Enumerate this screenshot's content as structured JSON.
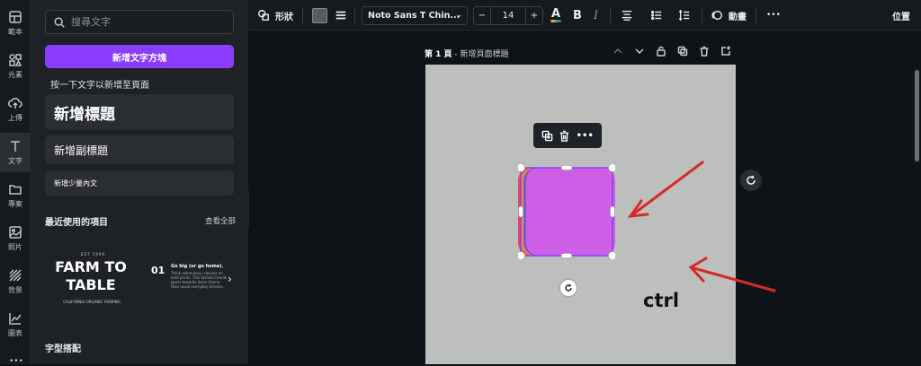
{
  "rail": {
    "items": [
      {
        "label": "範本",
        "icon": "template-icon"
      },
      {
        "label": "元素",
        "icon": "elements-icon"
      },
      {
        "label": "上傳",
        "icon": "upload-icon"
      },
      {
        "label": "文字",
        "icon": "text-icon"
      },
      {
        "label": "專案",
        "icon": "folder-icon"
      },
      {
        "label": "照片",
        "icon": "photo-icon"
      },
      {
        "label": "背景",
        "icon": "background-icon"
      },
      {
        "label": "圖表",
        "icon": "chart-icon"
      }
    ]
  },
  "panel": {
    "search_placeholder": "搜尋文字",
    "add_text_button": "新增文字方塊",
    "hint": "按一下文字以新增至頁面",
    "heading_card": "新增標題",
    "subheading_card": "新增副標題",
    "body_card": "新增少量內文",
    "recent_title": "最近使用的項目",
    "see_all": "查看全部",
    "template": {
      "est": "EST 1999",
      "title": "FARM TO\nTABLE",
      "subline": "CALIFORNIA ORGANIC FARMING",
      "number": "01",
      "heading": "Go big (or go home).",
      "paragraph": "Think voluminous sleeves on bold prints. This fashion trends gears towards more drama than usual everyday dresses."
    },
    "pairing_title": "字型搭配"
  },
  "toolbar": {
    "shape_label": "形狀",
    "font_name": "Noto Sans T Chin...",
    "font_size": "14",
    "size_minus": "−",
    "size_plus": "+",
    "bold": "B",
    "italic": "I",
    "animate_label": "動畫",
    "more": "•••",
    "position_label": "位置",
    "fill_color": "#595b5c",
    "text_color_bar": "#e53935"
  },
  "canvas": {
    "page_number": "第 1 頁",
    "page_title_placeholder": "新增頁面標題",
    "ctrl_text": "ctrl",
    "page_bg": "#bdbfbc",
    "shape_fill": "#cd5fe6",
    "arrow_color": "#d42b2b"
  }
}
